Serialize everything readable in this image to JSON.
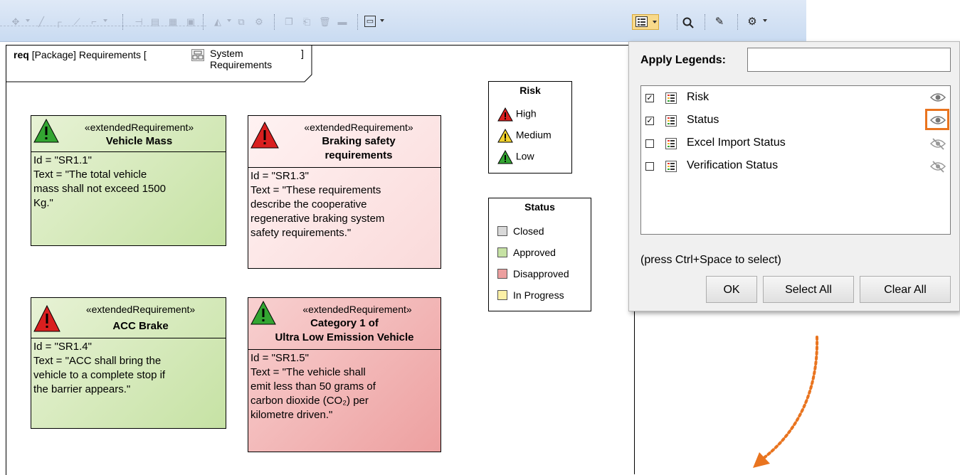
{
  "toolbar": {
    "legend_icon": "legend-icon",
    "settings_icon": "gear-icon",
    "search_icon": "search-icon"
  },
  "diagram": {
    "frame_kind": "req",
    "frame_title": "[Package] Requirements [",
    "frame_owner_line1": "System",
    "frame_owner_line2": "Requirements",
    "frame_close": "]",
    "requirements": [
      {
        "stereotype": "«extendedRequirement»",
        "name_line1": "Vehicle Mass",
        "name_line2": "",
        "id": "Id = \"SR1.1\"",
        "text": [
          "Text = \"The total vehicle",
          "mass shall not exceed 1500",
          "Kg.\""
        ],
        "risk": "Low",
        "status": "Approved"
      },
      {
        "stereotype": "«extendedRequirement»",
        "name_line1": "Braking safety",
        "name_line2": "requirements",
        "id": "Id = \"SR1.3\"",
        "text": [
          "Text = \"These requirements",
          "describe the cooperative",
          "regenerative braking system",
          "safety requirements.\""
        ],
        "risk": "High",
        "status": "Disapproved"
      },
      {
        "stereotype": "«extendedRequirement»",
        "name_line1": "ACC Brake",
        "name_line2": "",
        "id": "Id = \"SR1.4\"",
        "text": [
          "Text = \"ACC shall bring the",
          "vehicle to a complete stop if",
          "the barrier appears.\""
        ],
        "risk": "High",
        "status": "Approved"
      },
      {
        "stereotype": "«extendedRequirement»",
        "name_line1": "Category 1 of",
        "name_line2": "Ultra Low Emission Vehicle",
        "id": "Id = \"SR1.5\"",
        "text": [
          "Text = \"The vehicle shall",
          "emit less than 50 grams of",
          "carbon dioxide (CO₂) per",
          "kilometre driven.\""
        ],
        "risk": "Low",
        "status": "Disapproved"
      }
    ],
    "risk_legend": {
      "title": "Risk",
      "items": [
        {
          "label": "High",
          "color": "#d91f1f"
        },
        {
          "label": "Medium",
          "color": "#f2d22e"
        },
        {
          "label": "Low",
          "color": "#33a532"
        }
      ]
    },
    "status_legend": {
      "title": "Status",
      "items": [
        {
          "label": "Closed",
          "color": "#d9d9d9"
        },
        {
          "label": "Approved",
          "color": "#c6e2a4"
        },
        {
          "label": "Disapproved",
          "color": "#ec9f9f"
        },
        {
          "label": "In Progress",
          "color": "#fbf0a6"
        }
      ]
    }
  },
  "popup": {
    "apply_label": "Apply Legends:",
    "search_value": "",
    "legends": [
      {
        "label": "Risk",
        "checked": true,
        "visible": true
      },
      {
        "label": "Status",
        "checked": true,
        "visible": true
      },
      {
        "label": "Excel Import Status",
        "checked": false,
        "visible": false
      },
      {
        "label": "Verification Status",
        "checked": false,
        "visible": false
      }
    ],
    "hint": "(press Ctrl+Space to select)",
    "ok_label": "OK",
    "select_all_label": "Select All",
    "clear_all_label": "Clear All"
  },
  "colors": {
    "accent_orange": "#e9741f",
    "toolbar_bg": "#d4e2f4"
  }
}
